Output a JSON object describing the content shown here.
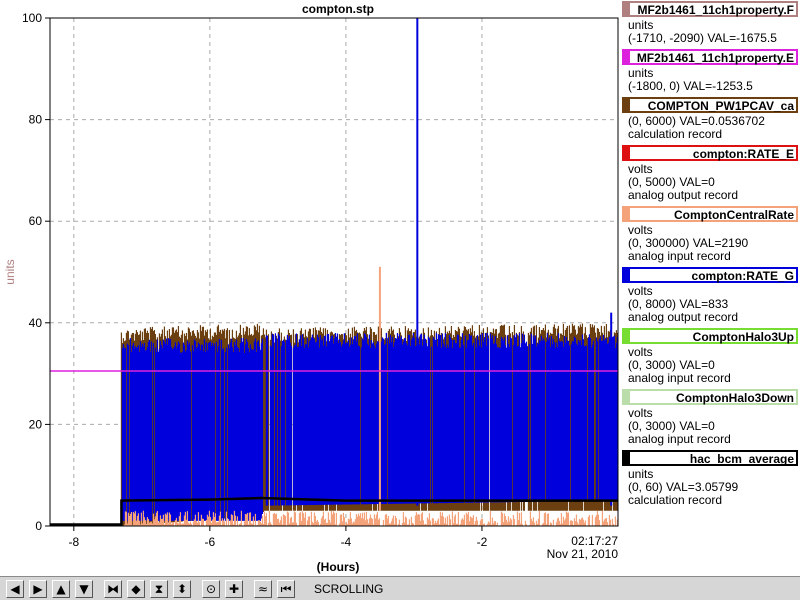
{
  "window_title": "compton.stp",
  "chart_data": {
    "type": "line",
    "title": "compton.stp",
    "xlabel": "(Hours)",
    "ylabel": "units",
    "xlim": [
      -8.35,
      0
    ],
    "ylim": [
      0,
      100
    ],
    "x_ticks": [
      -8,
      -6,
      -4,
      -2
    ],
    "y_ticks": [
      0,
      20,
      40,
      60,
      80,
      100
    ],
    "grid": true,
    "end_time": "02:17:27",
    "end_date": "Nov 21, 2010",
    "series": [
      {
        "name": "MF2b1461_11ch1property.E",
        "color": "#dd22dd",
        "style": "constant",
        "x": [
          -8.35,
          0
        ],
        "y": [
          30.5,
          30.5
        ]
      },
      {
        "name": "COMPTON_PW1PCAV_ca",
        "color": "#6b3f10",
        "style": "dense-band",
        "x": [
          -7.3,
          -5.25,
          -5.2,
          0
        ],
        "y_low": [
          0,
          2,
          3,
          3
        ],
        "y_high": [
          39,
          40,
          39,
          40
        ]
      },
      {
        "name": "compton:RATE_G",
        "color": "#0000dd",
        "style": "dense-band",
        "x": [
          -7.3,
          -5.25,
          -5.2,
          0
        ],
        "y_low": [
          1,
          1,
          4,
          5
        ],
        "y_high": [
          37,
          37,
          38,
          38
        ],
        "spikes": [
          {
            "x": -2.95,
            "y": 100
          },
          {
            "x": -0.1,
            "y": 42
          }
        ]
      },
      {
        "name": "ComptonCentralRate",
        "color": "#f4a27a",
        "style": "dense-band",
        "x": [
          -7.3,
          0
        ],
        "y_low": [
          0,
          0
        ],
        "y_high": [
          3,
          3
        ],
        "spikes": [
          {
            "x": -3.5,
            "y": 51
          }
        ]
      },
      {
        "name": "hac_bcm_average",
        "color": "#000000",
        "style": "line",
        "x": [
          -8.35,
          -7.3,
          -7.3,
          -6.0,
          -5.25,
          -4.0,
          -2.0,
          0
        ],
        "y": [
          0.3,
          0.3,
          5,
          5.2,
          5.5,
          5,
          5,
          5
        ]
      }
    ]
  },
  "legend": [
    {
      "name": "MF2b1461_11ch1property.F",
      "color": "#b08080",
      "lines": [
        "units",
        "(-1710, -2090) VAL=-1675.5"
      ]
    },
    {
      "name": "MF2b1461_11ch1property.E",
      "color": "#dd22dd",
      "lines": [
        "units",
        "(-1800, 0) VAL=-1253.5"
      ]
    },
    {
      "name": "COMPTON_PW1PCAV_ca",
      "color": "#6b3f10",
      "lines": [
        "(0, 6000) VAL=0.0536702",
        "calculation record"
      ]
    },
    {
      "name": "compton:RATE_E",
      "color": "#dd1111",
      "lines": [
        "volts",
        "(0, 5000) VAL=0",
        "analog output record"
      ]
    },
    {
      "name": "ComptonCentralRate",
      "color": "#f4a27a",
      "lines": [
        "volts",
        "(0, 300000) VAL=2190",
        "analog input record"
      ]
    },
    {
      "name": "compton:RATE_G",
      "color": "#0000dd",
      "lines": [
        "volts",
        "(0, 8000) VAL=833",
        "analog output record"
      ]
    },
    {
      "name": "ComptonHalo3Up",
      "color": "#77dd33",
      "lines": [
        "volts",
        "(0, 3000) VAL=0",
        "analog input record"
      ]
    },
    {
      "name": "ComptonHalo3Down",
      "color": "#bbddaa",
      "lines": [
        "volts",
        "(0, 3000) VAL=0",
        "analog input record"
      ]
    },
    {
      "name": "hac_bcm_average",
      "color": "#000000",
      "lines": [
        "units",
        "(0, 60) VAL=3.05799",
        "calculation record"
      ]
    }
  ],
  "toolbar": {
    "buttons": [
      {
        "name": "scroll-left",
        "glyph": "◀"
      },
      {
        "name": "scroll-right",
        "glyph": "▶"
      },
      {
        "name": "scroll-up",
        "glyph": "▲"
      },
      {
        "name": "scroll-down",
        "glyph": "▼"
      },
      {
        "name": "shrink-x",
        "glyph": "⧓"
      },
      {
        "name": "expand-x",
        "glyph": "◆"
      },
      {
        "name": "shrink-y",
        "glyph": "⧗"
      },
      {
        "name": "expand-y",
        "glyph": "⬍"
      },
      {
        "name": "auto-scale",
        "glyph": "⊙"
      },
      {
        "name": "center",
        "glyph": "✚"
      },
      {
        "name": "reset",
        "glyph": "≈"
      },
      {
        "name": "scroll-end",
        "glyph": "⏮"
      }
    ],
    "status": "SCROLLING"
  }
}
